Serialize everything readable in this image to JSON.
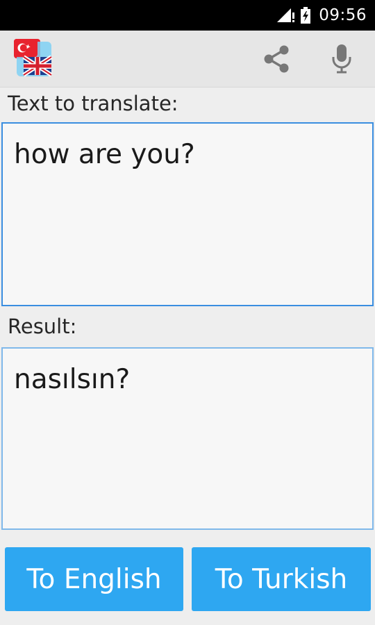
{
  "status_bar": {
    "time": "09:56",
    "icons": [
      "signal-icon",
      "battery-charging-icon"
    ]
  },
  "action_bar": {
    "logo_icon": "turkish-english-flags-icon",
    "actions": [
      "share-icon",
      "microphone-icon"
    ]
  },
  "source": {
    "label": "Text to translate:",
    "value": "how are you?"
  },
  "result": {
    "label": "Result:",
    "value": "nasılsın?"
  },
  "buttons": {
    "to_english": "To English",
    "to_turkish": "To Turkish"
  },
  "colors": {
    "accent": "#2ea7f1",
    "field_border": "#3a8ee0",
    "background": "#eeeeee"
  }
}
